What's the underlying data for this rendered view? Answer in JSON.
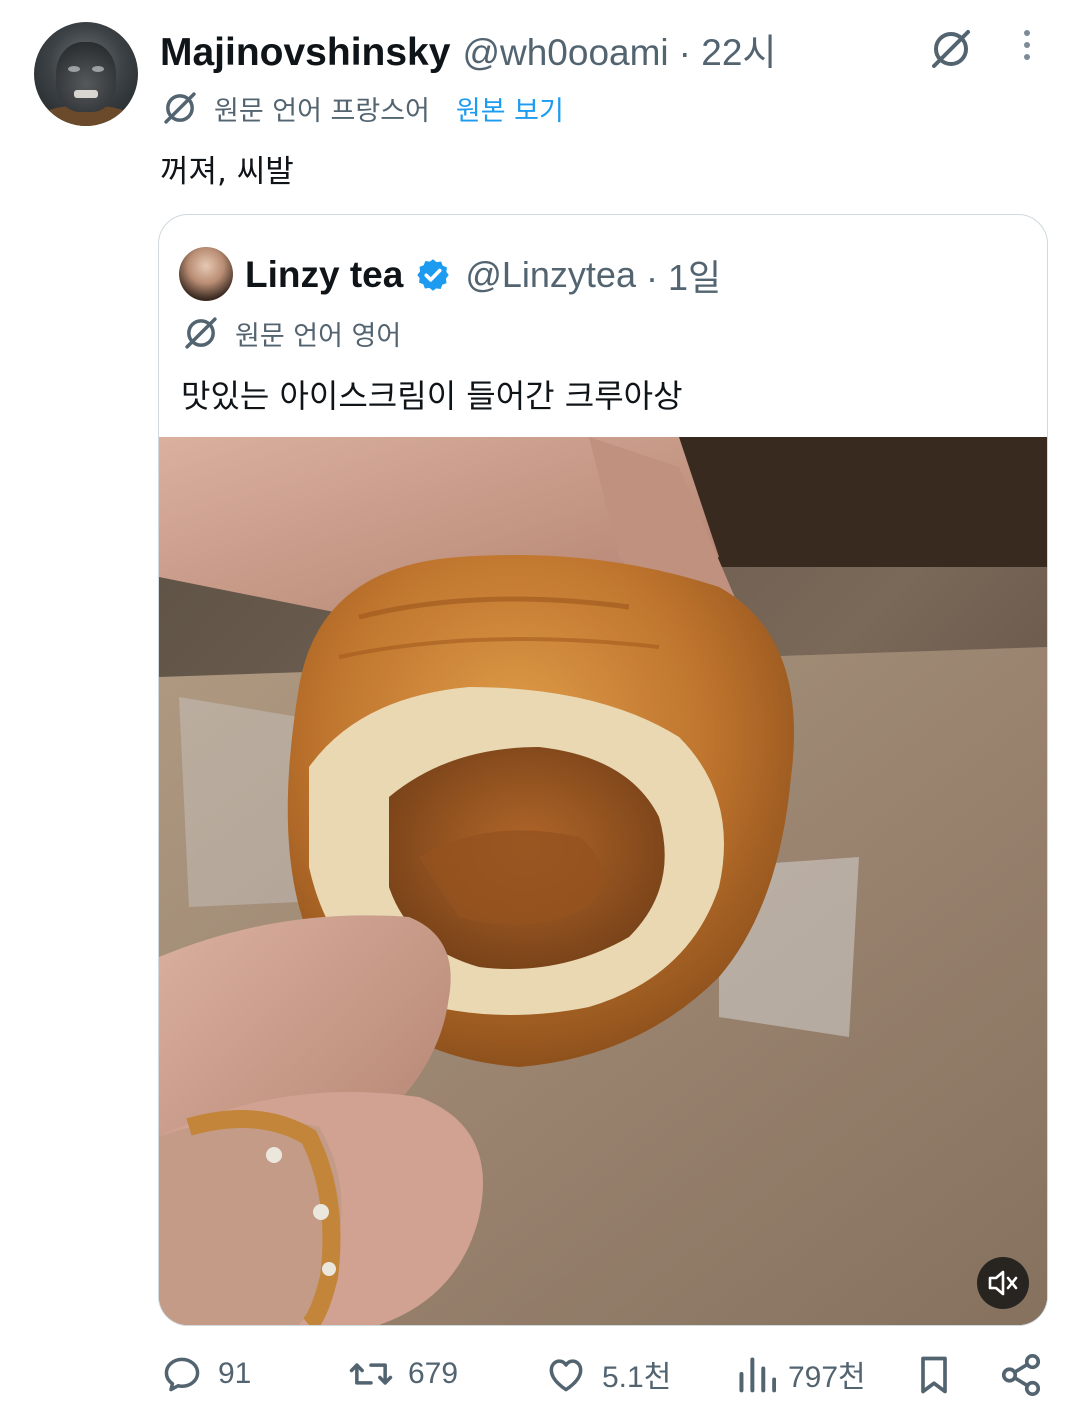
{
  "tweet": {
    "author_name": "Majinovshinsky",
    "author_handle": "@wh0ooami",
    "timestamp": "· 22시",
    "translation": {
      "label": "원문 언어 프랑스어",
      "show_original": "원본 보기"
    },
    "text": "꺼져, 씨발"
  },
  "quoted_tweet": {
    "author_name": "Linzy tea",
    "author_handle": "@Linzytea",
    "timestamp": "· 1일",
    "verified": true,
    "translation_label": "원문 언어 영어",
    "text": "맛있는 아이스크림이 들어간 크루아상",
    "media": {
      "type": "video",
      "muted": true
    }
  },
  "actions": {
    "replies": "91",
    "retweets": "679",
    "likes": "5.1천",
    "views": "797천"
  },
  "icons": {
    "translate": "translate-icon",
    "more": "more-options-icon",
    "verified": "verified-badge-icon",
    "mute": "mute-icon",
    "reply": "reply-icon",
    "retweet": "retweet-icon",
    "like": "like-icon",
    "views": "views-icon",
    "bookmark": "bookmark-icon",
    "share": "share-icon"
  },
  "colors": {
    "accent": "#1d9bf0",
    "secondary_text": "#536471",
    "verified": "#1d9bf0",
    "border": "#cfd9de"
  }
}
